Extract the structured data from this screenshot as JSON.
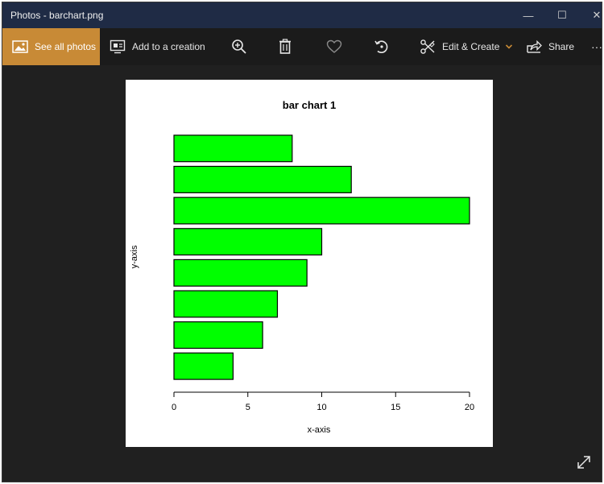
{
  "window": {
    "title": "Photos - barchart.png",
    "controls": {
      "minimize": "—",
      "maximize": "☐",
      "close": "✕"
    }
  },
  "toolbar": {
    "see_all_label": "See all photos",
    "add_to_creation_label": "Add to a creation",
    "edit_create_label": "Edit & Create",
    "share_label": "Share",
    "more_label": "···",
    "accent_color": "#c88a36",
    "icons": [
      "image-icon",
      "add-creation-icon",
      "zoom-in-icon",
      "delete-icon",
      "favorite-heart-icon",
      "rotate-icon",
      "edit-create-icon",
      "chevron-down-icon",
      "share-icon",
      "more-icon",
      "expand-icon"
    ]
  },
  "chart_data": {
    "type": "bar",
    "orientation": "horizontal",
    "title": "bar chart 1",
    "xlabel": "x-axis",
    "ylabel": "y-axis",
    "values": [
      4,
      6,
      7,
      9,
      10,
      20,
      12,
      8
    ],
    "xlim": [
      0,
      20
    ],
    "xticks": [
      0,
      5,
      10,
      15,
      20
    ],
    "bar_color": "#00ff00",
    "bar_border_color": "#000000",
    "grid": false
  }
}
